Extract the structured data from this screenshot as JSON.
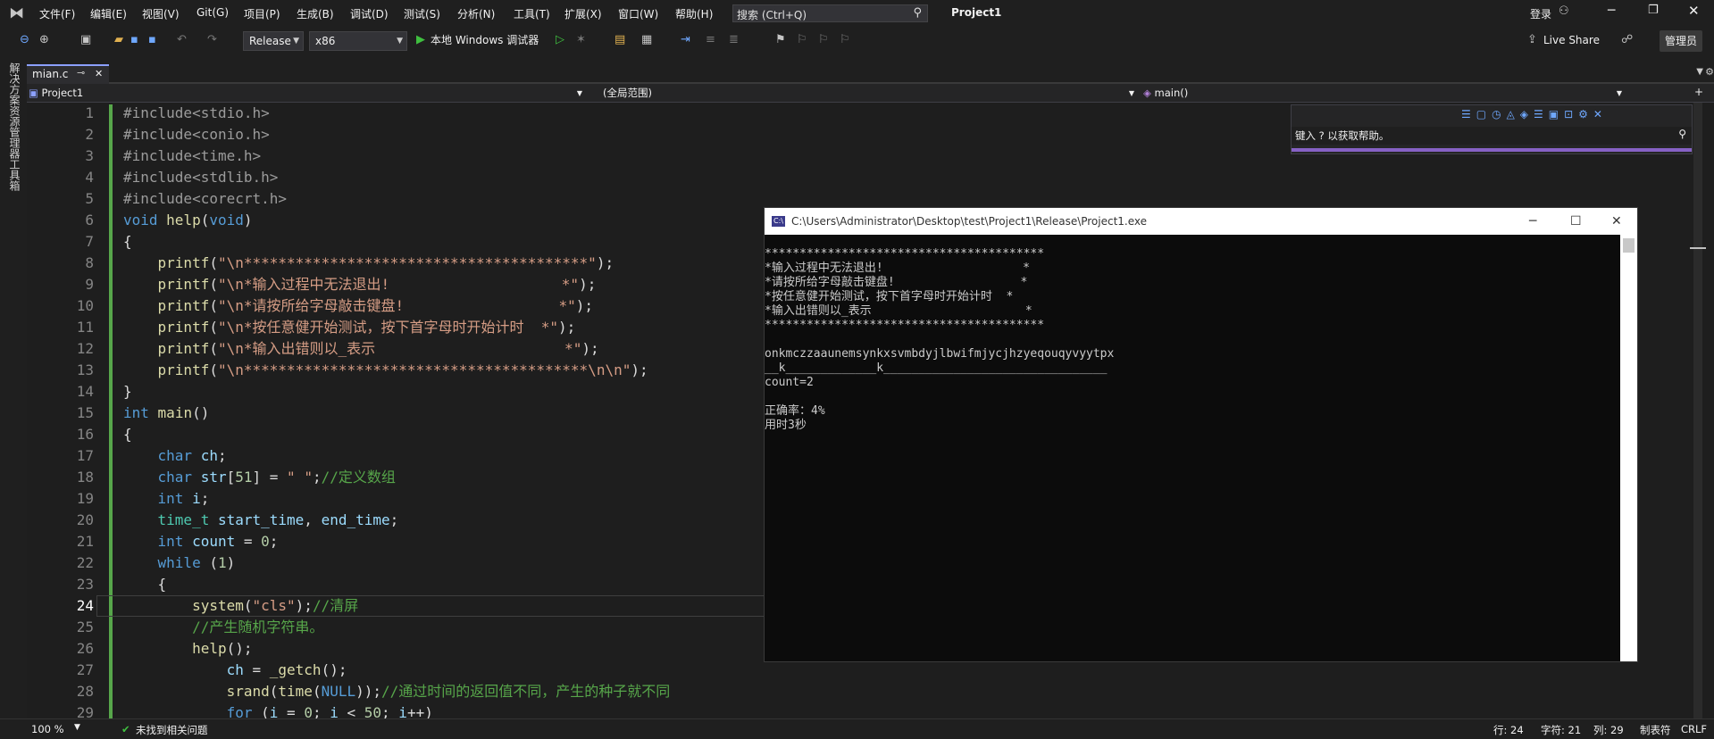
{
  "menubar": {
    "items": [
      "文件(F)",
      "编辑(E)",
      "视图(V)",
      "Git(G)",
      "项目(P)",
      "生成(B)",
      "调试(D)",
      "测试(S)",
      "分析(N)",
      "工具(T)",
      "扩展(X)",
      "窗口(W)",
      "帮助(H)"
    ],
    "search_placeholder": "搜索 (Ctrl+Q)",
    "project_title": "Project1",
    "login_label": "登录"
  },
  "toolbar": {
    "config_value": "Release",
    "platform_value": "x86",
    "run_label": "本地 Windows 调试器",
    "live_share_label": "Live Share",
    "admin_label": "管理员"
  },
  "side_tabs": [
    "解决方案资源管理器",
    "工具箱"
  ],
  "doc_tab": {
    "label": "mian.c"
  },
  "navbar": {
    "project": "Project1",
    "scope": "(全局范围)",
    "member": "main()"
  },
  "help_panel": {
    "placeholder": "键入 ? 以获取帮助。"
  },
  "console": {
    "title": "C:\\Users\\Administrator\\Desktop\\test\\Project1\\Release\\Project1.exe",
    "lines": [
      "****************************************",
      "*输入过程中无法退出!                    *",
      "*请按所给字母敲击键盘!                  *",
      "*按任意健开始测试，按下首字母时开始计时  *",
      "*输入出错则以_表示                      *",
      "****************************************",
      "",
      "onkmczzaaunemsynkxsvmbdyjlbwifmjycjhzyeqouqyvyytpx",
      "__k_____________k________________________________",
      "count=2",
      "",
      "正确率：4%",
      "用时3秒"
    ]
  },
  "editor": {
    "line_numbers": [
      "1",
      "2",
      "3",
      "4",
      "5",
      "6",
      "7",
      "8",
      "9",
      "10",
      "11",
      "12",
      "13",
      "14",
      "15",
      "16",
      "17",
      "18",
      "19",
      "20",
      "21",
      "22",
      "23",
      "24",
      "25",
      "26",
      "27",
      "28",
      "29"
    ],
    "current_line": "24"
  },
  "statusbar": {
    "zoom": "100 %",
    "issues": "未找到相关问题",
    "line": "行: 24",
    "char": "字符: 21",
    "col": "列: 29",
    "tabs": "制表符",
    "eol": "CRLF"
  },
  "colors": {
    "accent": "#8ca0ff",
    "background": "#1e1e1e",
    "console_bg": "#0c0c0c",
    "purple_bar": "#8661c5"
  }
}
